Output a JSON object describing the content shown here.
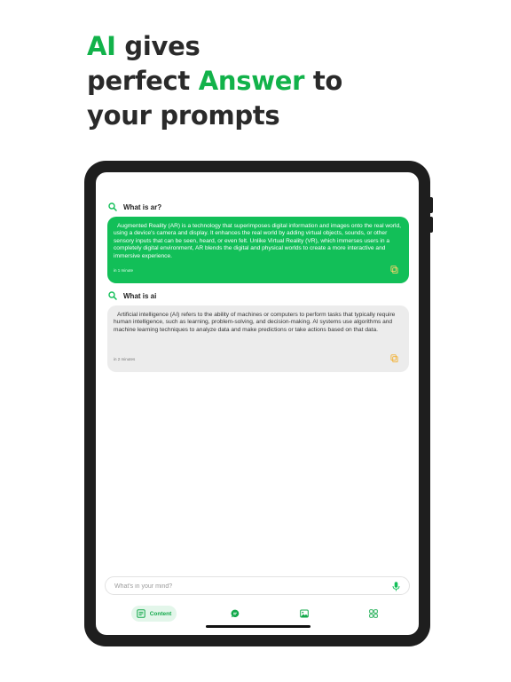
{
  "headline": {
    "line1_accent": "AI",
    "line1_rest": " gives",
    "line2_pre": "perfect ",
    "line2_accent": "Answer",
    "line2_post": " to",
    "line3": "your prompts"
  },
  "colors": {
    "accent": "#12bf58",
    "headline": "#2a2a2a",
    "grey_bubble": "#ececec",
    "copy_icon": "#f2b134"
  },
  "conversation": [
    {
      "query": "What is ar?",
      "answer": "Augmented Reality (AR) is a technology that superimposes digital information and images onto the real world, using a device's camera and display. It enhances the real world by adding virtual objects, sounds, or other sensory inputs that can be seen, heard, or even felt. Unlike Virtual Reality (VR), which immerses users in a completely digital environment, AR blends the digital and physical worlds to create a more interactive and immersive experience.",
      "time": "in 1 minute",
      "icon": "search-icon"
    },
    {
      "query": "What is ai",
      "answer": "Artificial intelligence (AI) refers to the ability of machines or computers to perform tasks that typically require human intelligence, such as learning, problem-solving, and decision-making. AI systems use algorithms and machine learning techniques to analyze data and make predictions or take actions based on that data.",
      "time": "in 2 minutes",
      "icon": "search-icon"
    }
  ],
  "input": {
    "placeholder": "What's in your mind?",
    "value": "",
    "icon": "mic-icon"
  },
  "nav": {
    "active_label": "Content",
    "items": [
      "content-icon",
      "chat-icon",
      "image-icon",
      "apps-icon"
    ]
  }
}
